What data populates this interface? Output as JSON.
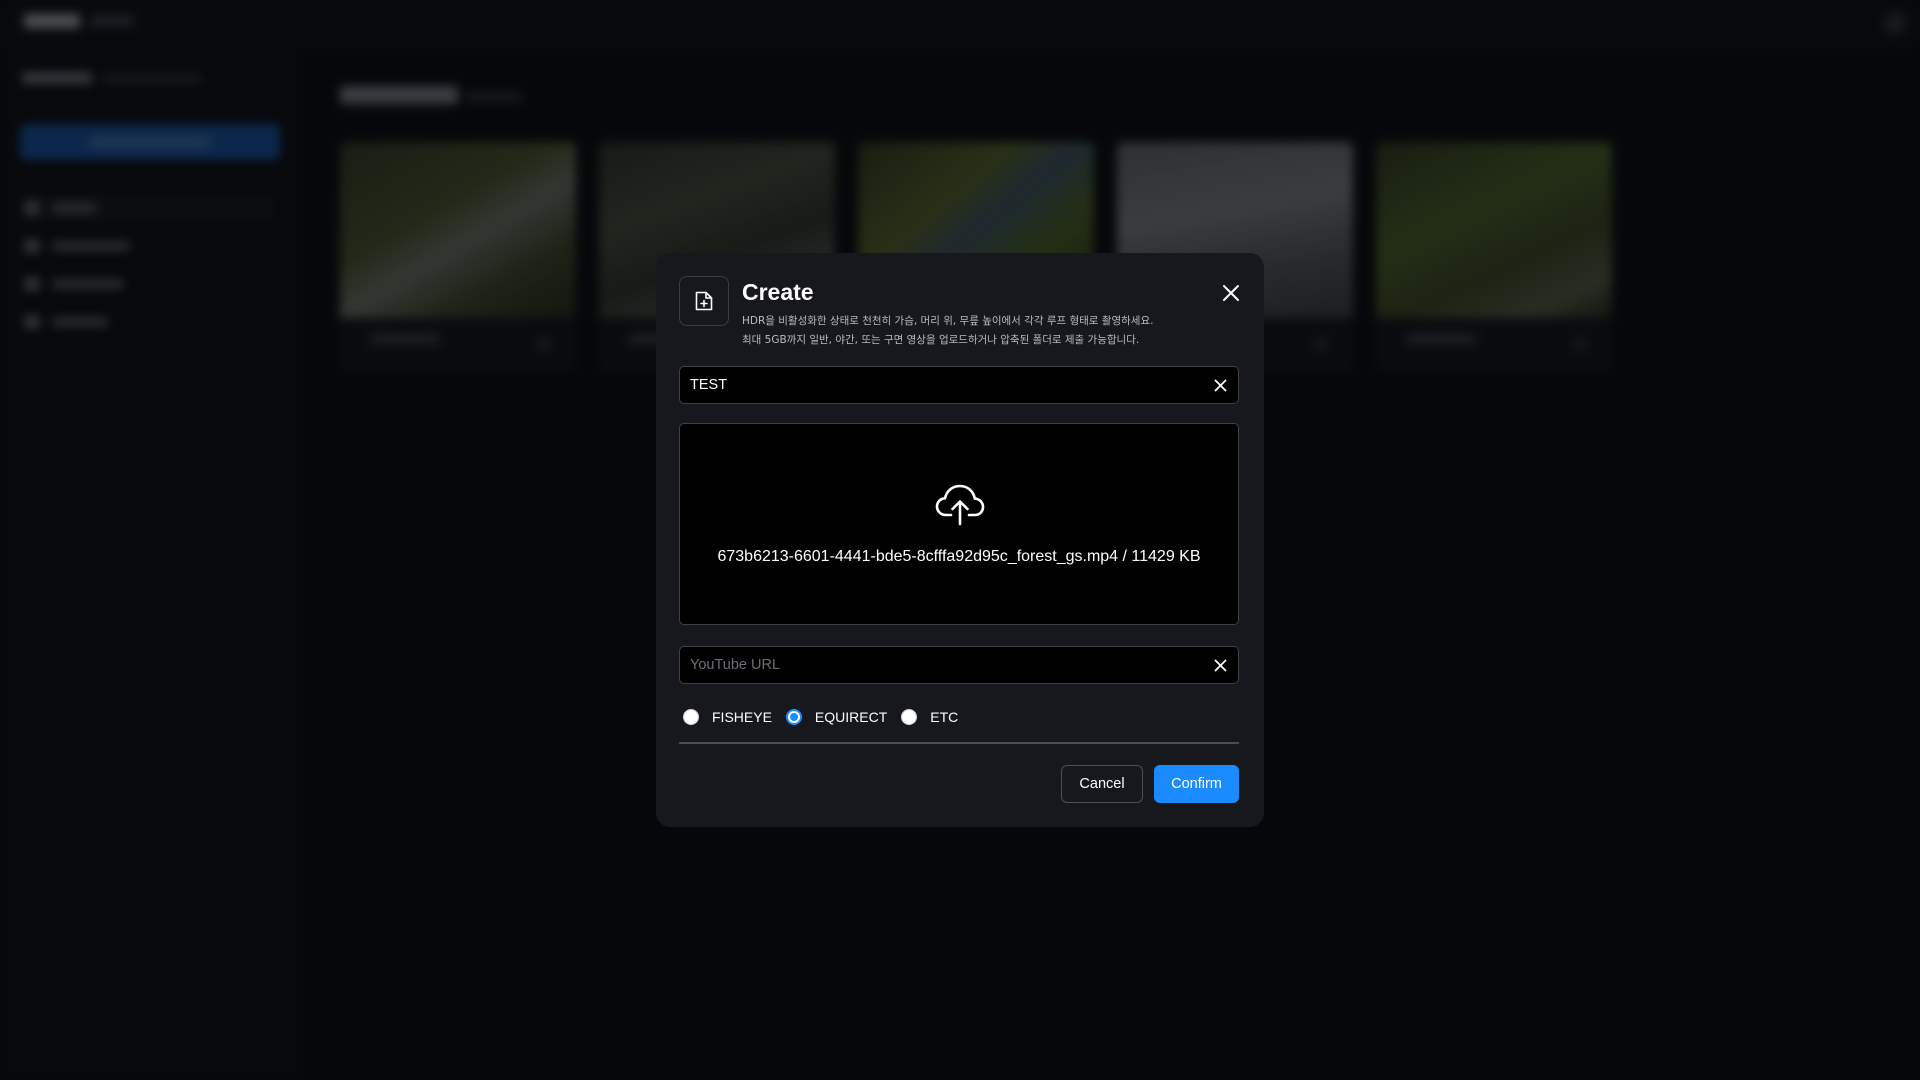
{
  "modal": {
    "title": "Create",
    "description_lines": [
      "HDR을 비활성화한 상태로 천천히 가슴, 머리 위, 무릎 높이에서 각각 루프 형태로 촬영하세요.",
      "최대 5GB까지 일반, 야간, 또는 구면 영상을 업로드하거나 압축된 폴더로 제출 가능합니다."
    ],
    "name_input": {
      "value": "TEST",
      "placeholder": ""
    },
    "upload": {
      "file_info": "673b6213-6601-4441-bde5-8cfffa92d95c_forest_gs.mp4 / 11429 KB"
    },
    "youtube_input": {
      "value": "",
      "placeholder": "YouTube URL"
    },
    "projection_options": [
      {
        "label": "FISHEYE",
        "checked": false
      },
      {
        "label": "EQUIRECT",
        "checked": true
      },
      {
        "label": "ETC",
        "checked": false
      }
    ],
    "cancel_label": "Cancel",
    "confirm_label": "Confirm"
  },
  "icons": {
    "header": "file-plus-icon",
    "close": "close-icon",
    "clear": "clear-icon",
    "upload": "cloud-upload-icon"
  },
  "colors": {
    "accent": "#1a8cff",
    "modal_bg": "#16181d",
    "field_bg": "#000000",
    "page_bg": "#0a0c10"
  }
}
